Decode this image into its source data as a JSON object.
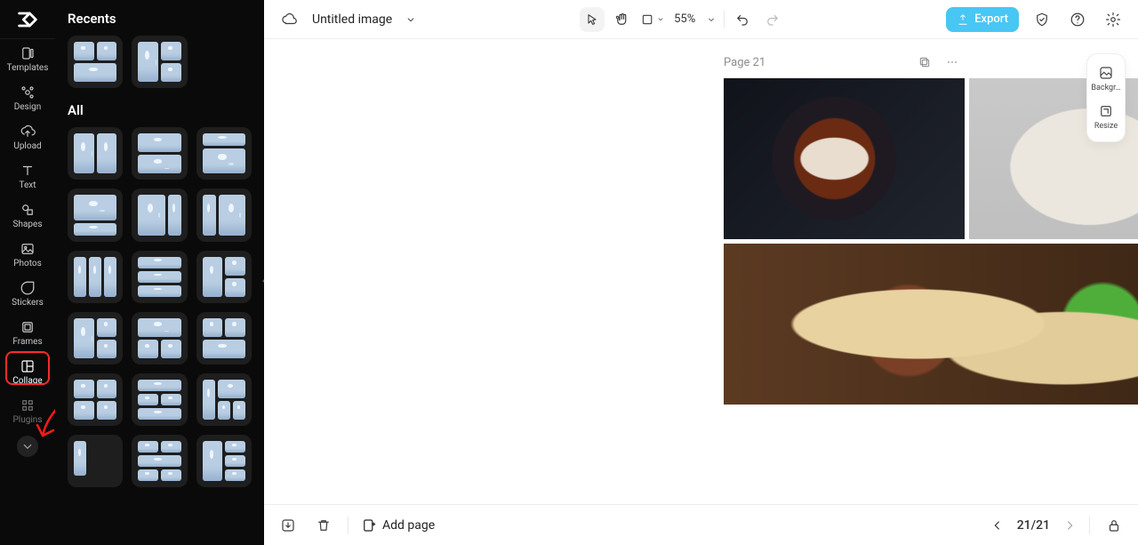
{
  "rail": {
    "items": [
      {
        "key": "templates",
        "label": "Templates"
      },
      {
        "key": "design",
        "label": "Design"
      },
      {
        "key": "upload",
        "label": "Upload"
      },
      {
        "key": "text",
        "label": "Text"
      },
      {
        "key": "shapes",
        "label": "Shapes"
      },
      {
        "key": "photos",
        "label": "Photos"
      },
      {
        "key": "stickers",
        "label": "Stickers"
      },
      {
        "key": "frames",
        "label": "Frames"
      },
      {
        "key": "collage",
        "label": "Collage"
      },
      {
        "key": "plugins",
        "label": "Plugins"
      }
    ]
  },
  "panel": {
    "recents_title": "Recents",
    "all_title": "All"
  },
  "topbar": {
    "title": "Untitled image",
    "zoom": "55%",
    "export": "Export"
  },
  "float": {
    "background": "Backgr…",
    "resize": "Resize"
  },
  "page": {
    "label": "Page 21"
  },
  "bottom": {
    "add_page": "Add page",
    "pager": "21/21"
  }
}
